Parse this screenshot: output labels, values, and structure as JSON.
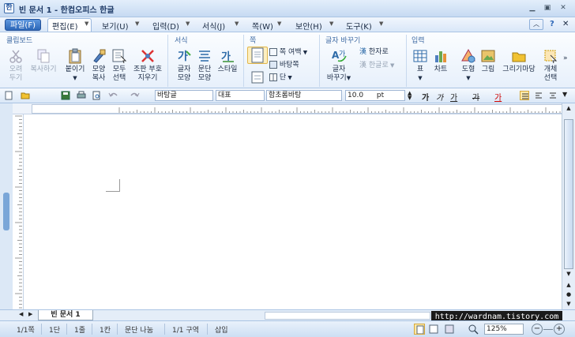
{
  "window": {
    "title": "빈 문서 1 - 한컴오피스 한글",
    "app_icon": "한"
  },
  "menubar": {
    "file": "파일(F)",
    "items": [
      "편집(E)",
      "보기(U)",
      "입력(D)",
      "서식(J)",
      "쪽(W)",
      "보안(H)",
      "도구(K)"
    ],
    "help": "?"
  },
  "ribbon": {
    "groups": [
      "클립보드",
      "서식",
      "쪽",
      "글자 바꾸기",
      "입력"
    ],
    "clipboard": {
      "cut": [
        "오려",
        "두기"
      ],
      "copy": "복사하기",
      "paste": "붙이기",
      "format_copy": [
        "모양",
        "복사"
      ],
      "select_all": [
        "모두",
        "선택"
      ],
      "erase_format": [
        "조판 부호",
        "지우기"
      ]
    },
    "format": {
      "char_shape": [
        "글자",
        "모양"
      ],
      "para_shape": [
        "문단",
        "모양"
      ],
      "style": "스타일"
    },
    "page": {
      "page_margin": "쪽 여백",
      "background": "바탕쪽",
      "column": "단"
    },
    "convert": {
      "char_convert": [
        "글자",
        "바꾸기"
      ],
      "to_hanja": "한자로",
      "to_hangul": "한글로"
    },
    "insert": {
      "table": "표",
      "chart": "차트",
      "shape": "도형",
      "picture": "그림",
      "drawing": "그리기마당",
      "object": [
        "개체",
        "선택"
      ]
    }
  },
  "toolbar": {
    "style": "바탕글",
    "language": "대표",
    "font": "함초롬바탕",
    "size": "10.0",
    "unit": "pt",
    "bold": "가",
    "italic": "가",
    "underline": "가",
    "strike": "가",
    "color": "가"
  },
  "doc_tab": "빈 문서 1",
  "status": {
    "page": "1/1쪽",
    "column": "1단",
    "line": "1줄",
    "char": "1칸",
    "break": "문단 나눔",
    "section": "1/1 구역",
    "mode": "삽입",
    "zoom": "125%"
  },
  "watermark": "http://wardnam.tistory.com"
}
